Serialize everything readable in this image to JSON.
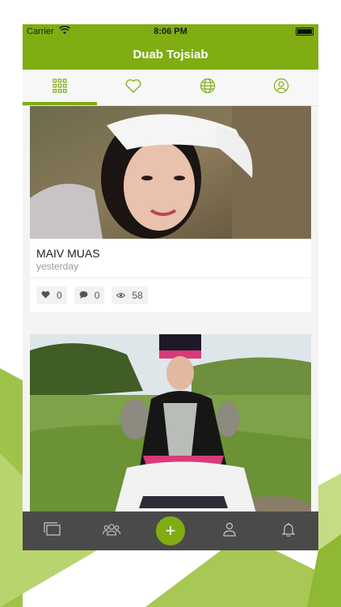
{
  "status_bar": {
    "carrier": "Carrier",
    "time": "8:06 PM"
  },
  "nav": {
    "title": "Duab Tojsiab"
  },
  "tabs": [
    {
      "icon": "grid-icon",
      "active": true
    },
    {
      "icon": "heart-icon",
      "active": false
    },
    {
      "icon": "globe-icon",
      "active": false
    },
    {
      "icon": "user-circle-icon",
      "active": false
    }
  ],
  "posts": [
    {
      "title": "MAIV MUAS",
      "date": "yesterday",
      "likes": "0",
      "comments": "0",
      "views": "58"
    }
  ],
  "bottom_bar": {
    "items": [
      "albums-icon",
      "people-icon",
      "add-icon",
      "profile-icon",
      "bell-icon"
    ],
    "add_label": "+"
  },
  "colors": {
    "brand": "#7fad12",
    "bottom_bar": "#4a4a4a"
  }
}
